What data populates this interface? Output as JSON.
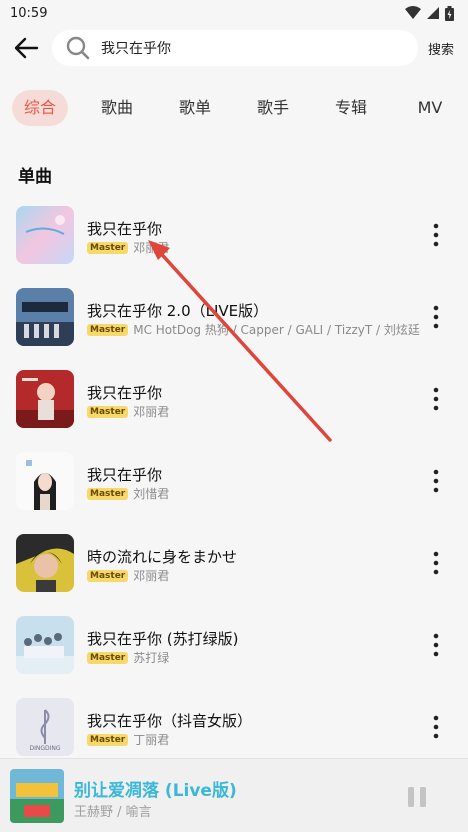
{
  "status_bar": {
    "time": "10:59"
  },
  "search": {
    "value": "我只在乎你",
    "button_label": "搜索"
  },
  "tabs": [
    "综合",
    "歌曲",
    "歌单",
    "歌手",
    "专辑",
    "MV"
  ],
  "section_title": "单曲",
  "badge": "Master",
  "songs": [
    {
      "title": "我只在乎你",
      "artist": "邓丽君"
    },
    {
      "title": "我只在乎你 2.0（LIVE版）",
      "artist": "MC HotDog 热狗 / Capper / GALI / TizzyT / 刘炫廷"
    },
    {
      "title": "我只在乎你",
      "artist": "邓丽君"
    },
    {
      "title": "我只在乎你",
      "artist": "刘惜君"
    },
    {
      "title": "時の流れに身をまかせ",
      "artist": "邓丽君"
    },
    {
      "title": "我只在乎你 (苏打绿版)",
      "artist": "苏打绿"
    },
    {
      "title": "我只在乎你（抖音女版）",
      "artist": "丁丽君"
    }
  ],
  "covers": {
    "c7_label": "DINGDING"
  },
  "now_playing": {
    "title": "别让爱凋落 (Live版)",
    "artist": "王赫野 / 喻言"
  },
  "colors": {
    "accent": "#e85a46",
    "badge": "#f7d96a",
    "player_title": "#3bb8d8",
    "annotation_arrow": "#e0453a"
  }
}
